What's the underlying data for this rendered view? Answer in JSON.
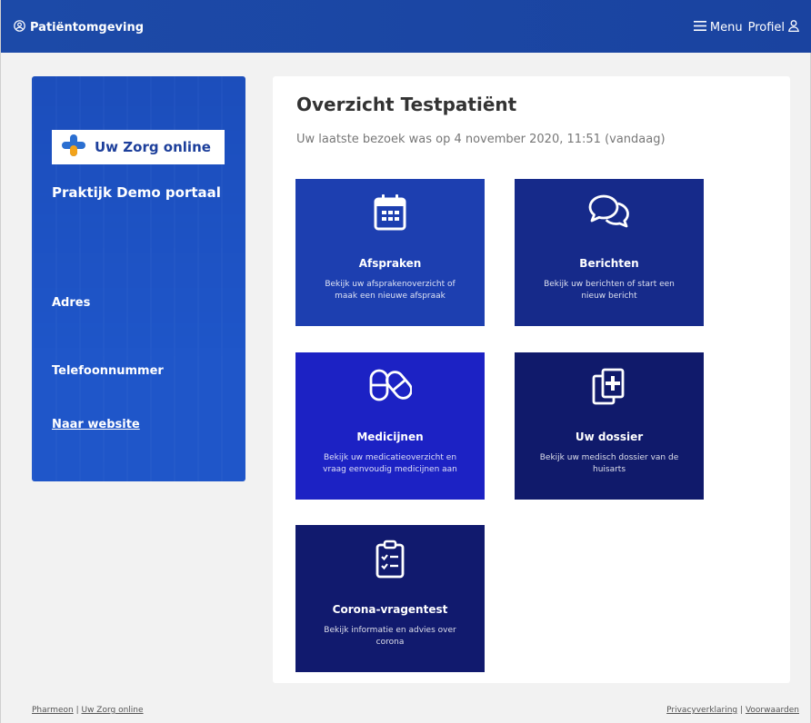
{
  "header": {
    "brand": "Patiëntomgeving",
    "menu_label": "Menu",
    "profile_label": "Profiel"
  },
  "sidebar": {
    "logo_text": "Uw Zorg online",
    "title": "Praktijk Demo portaal",
    "address_label": "Adres",
    "phone_label": "Telefoonnummer",
    "website_link": "Naar website"
  },
  "main": {
    "title": "Overzicht Testpatiënt",
    "last_visit": "Uw laatste bezoek was op 4 november 2020, 11:51 (vandaag)",
    "tiles": [
      {
        "title": "Afspraken",
        "desc": "Bekijk uw afsprakenoverzicht of maak een nieuwe afspraak",
        "icon": "calendar-icon"
      },
      {
        "title": "Berichten",
        "desc": "Bekijk uw berichten of start een nieuw bericht",
        "icon": "chat-icon"
      },
      {
        "title": "Medicijnen",
        "desc": "Bekijk uw medicatieoverzicht en vraag eenvoudig medicijnen aan",
        "icon": "pills-icon"
      },
      {
        "title": "Uw dossier",
        "desc": "Bekijk uw medisch dossier van de huisarts",
        "icon": "medical-file-icon"
      },
      {
        "title": "Corona-vragentest",
        "desc": "Bekijk informatie en advies over corona",
        "icon": "checklist-icon"
      }
    ]
  },
  "footer": {
    "left_links": [
      "Pharmeon",
      "Uw Zorg online"
    ],
    "right_links": [
      "Privacyverklaring",
      "Voorwaarden"
    ],
    "separator": "|"
  },
  "colors": {
    "header": "#1c4aa8",
    "sidebar": "#1f56c9",
    "tile_afspraken": "#1d3fb0",
    "tile_berichten": "#162a8a",
    "tile_medicijnen": "#1c22c4",
    "tile_dossier": "#101a6b",
    "tile_corona": "#111a6e"
  }
}
